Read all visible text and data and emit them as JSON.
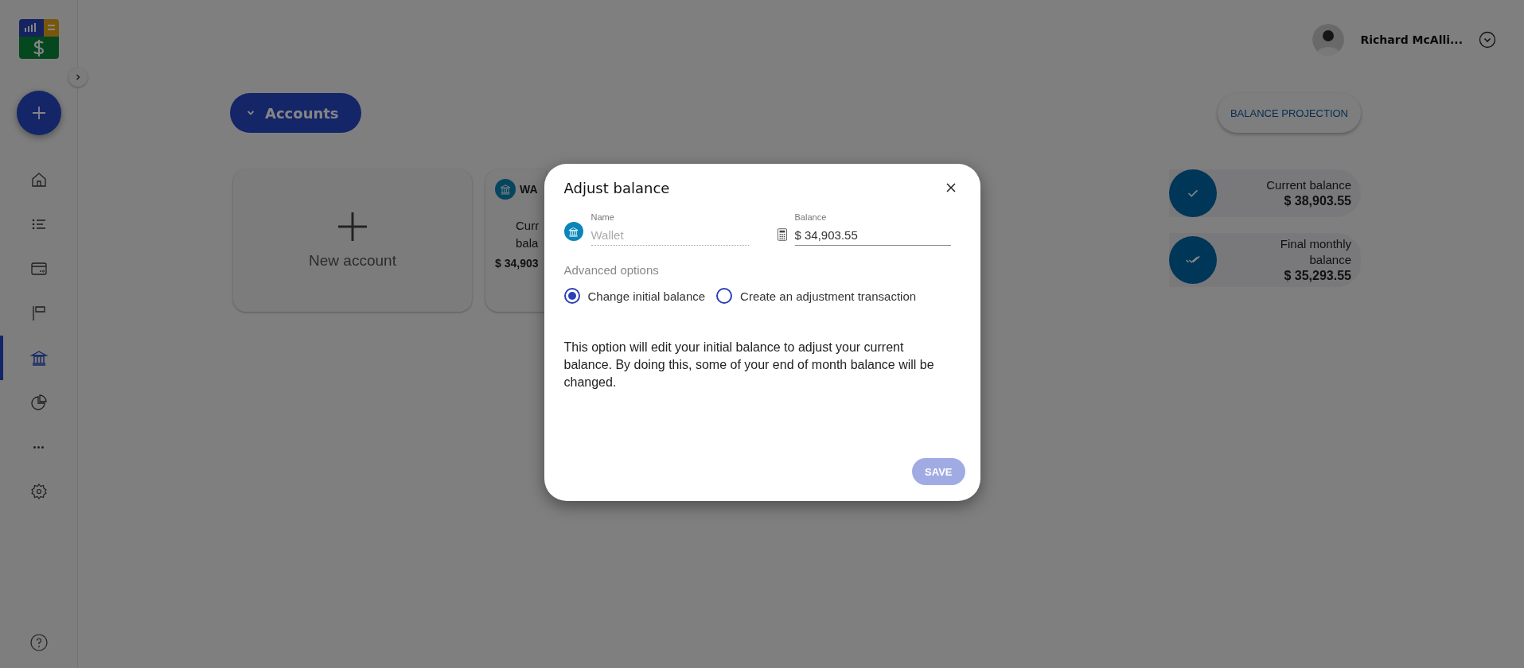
{
  "sidebar": {
    "items": [
      {
        "kind": "home",
        "selected": false
      },
      {
        "kind": "list",
        "selected": false
      },
      {
        "kind": "wallet",
        "selected": false
      },
      {
        "kind": "flag",
        "selected": false
      },
      {
        "kind": "bank",
        "selected": true
      },
      {
        "kind": "chart",
        "selected": false
      },
      {
        "kind": "more",
        "selected": false
      },
      {
        "kind": "settings",
        "selected": false
      }
    ]
  },
  "user": {
    "name": "Richard McAlli..."
  },
  "toolbar": {
    "section_button": "Accounts",
    "projection_button": "BALANCE PROJECTION"
  },
  "accounts": {
    "new_account": "New account",
    "cards": [
      {
        "name": "WA",
        "label": "Curr bala",
        "balance": "$ 34,903"
      }
    ]
  },
  "summary": [
    {
      "kind": "current",
      "label": "Current balance",
      "value": "$ 38,903.55"
    },
    {
      "kind": "final",
      "label": "Final monthly balance",
      "value": "$ 35,293.55"
    }
  ],
  "dialog": {
    "title": "Adjust balance",
    "name_field": {
      "label": "Name",
      "placeholder": "Wallet"
    },
    "balance_field": {
      "label": "Balance",
      "value": "$ 34,903.55"
    },
    "advanced_label": "Advanced options",
    "options": [
      {
        "label": "Change initial balance",
        "selected": true
      },
      {
        "label": "Create an adjustment transaction",
        "selected": false
      }
    ],
    "description": "This option will edit your initial balance to adjust your current balance. By doing this, some of your end of month balance will be changed.",
    "save_button": {
      "label": "SAVE",
      "disabled": true
    }
  }
}
